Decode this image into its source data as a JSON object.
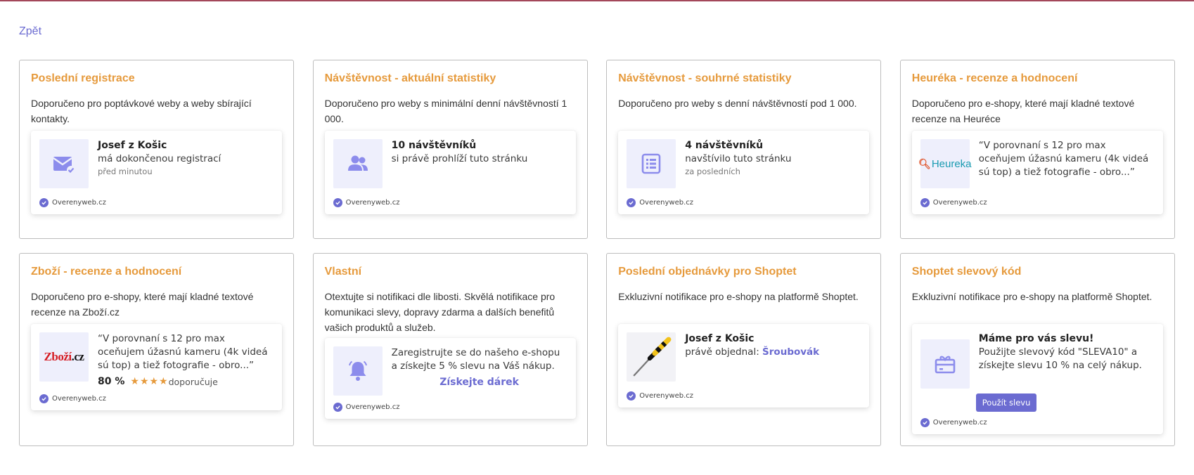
{
  "nav": {
    "back_label": "Zpět"
  },
  "brand": "Overenyweb.cz",
  "cards": [
    {
      "title": "Poslední registrace",
      "desc": "Doporučeno pro poptávkové weby a weby sbírající kontakty.",
      "icon": "mail-check-icon",
      "name": "Josef z Košic",
      "line": "má dokončenou registrací",
      "small": "před minutou"
    },
    {
      "title": "Návštěvnost - aktuální statistiky",
      "desc": "Doporučeno pro weby s minimální denní návštěvností 1 000.",
      "icon": "users-icon",
      "name": "10 návštěvníků",
      "line": "si právě prohlíží tuto stránku"
    },
    {
      "title": "Návštěvnost - souhrné statistiky",
      "desc": "Doporučeno pro weby s denní návštěvností pod 1 000.",
      "icon": "list-icon",
      "name": "4 návštěvníků",
      "line": "navštívilo tuto stránku",
      "small": "za posledních"
    },
    {
      "title": "Heuréka - recenze a hodnocení",
      "desc": "Doporučeno pro e-shopy, které mají kladné textové recenze na Heuréce",
      "logo": "Heureka",
      "quote": "“V porovnaní s 12 pro max oceňujem úžasnú kameru (4k videá sú top) a tiež fotografie - obro...”"
    },
    {
      "title": "Zboží - recenze a hodnocení",
      "desc": "Doporučeno pro e-shopy, které mají kladné textové recenze na Zboží.cz",
      "logo_a": "Zboží",
      "logo_b": ".cz",
      "quote": "“V porovnaní s 12 pro max oceňujem úžasnú kameru (4k videá sú top) a tiež fotografie - obro...”",
      "percent": "80 %",
      "stars": "★★★★",
      "rating_label": "doporučuje"
    },
    {
      "title": "Vlastní",
      "desc": "Otextujte si notifikaci dle libosti. Skvělá notifikace pro komunikaci slevy, dopravy zdarma a dalších benefitů vašich produktů a služeb.",
      "icon": "bell-icon",
      "line": "Zaregistrujte se do našeho e-shopu a získejte 5 % slevu na Váš nákup.",
      "cta": "Získejte dárek"
    },
    {
      "title": "Poslední objednávky pro Shoptet",
      "desc": "Exkluzivní notifikace pro e-shopy na platformě Shoptet.",
      "icon": "screwdriver-icon",
      "name": "Josef z Košic",
      "line_prefix": "právě objednal: ",
      "product": "Šroubovák"
    },
    {
      "title": "Shoptet slevový kód",
      "desc": "Exkluzivní notifikace pro e-shopy na platformě Shoptet.",
      "icon": "gift-card-icon",
      "name": "Máme pro vás slevu!",
      "line": "Použijte slevový kód \"SLEVA10\" a získejte slevu 10 % na celý nákup.",
      "button": "Použít slevu"
    }
  ],
  "colors": {
    "accent": "#6b6bd1",
    "title": "#e69a3c",
    "thumb_bg": "#eeeffc"
  }
}
